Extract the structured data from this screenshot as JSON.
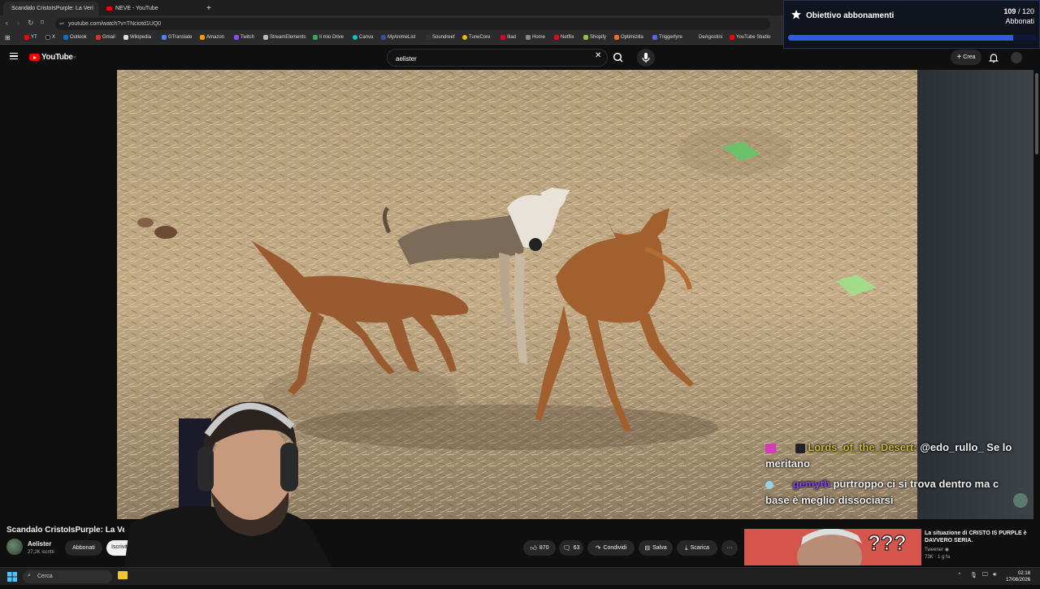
{
  "browser": {
    "tabs": [
      {
        "label": "Scandalo CristoIsPurple: La Veri",
        "active": true
      },
      {
        "label": "NEVE - YouTube",
        "active": false
      }
    ],
    "new_tab": "+",
    "url": "youtube.com/watch?v=TNciotd1UQ0",
    "bookmarks": [
      "YT",
      "X",
      "Outlook",
      "Gmail",
      "Wikipedia",
      "GTranslate",
      "Amazon",
      "Twitch",
      "StreamElements",
      "Il mio Drive",
      "Canva",
      "MyAnimeList",
      "Soundreef",
      "TuneCore",
      "Iliad",
      "Home",
      "Netflix",
      "Shopify",
      "Optimizilla",
      "Triggerfyre",
      "DeAgostini",
      "YouTube Studio"
    ]
  },
  "youtube": {
    "logo_text": "YouTube",
    "logo_region": "IT",
    "search_value": "aelister",
    "create_label": "Crea"
  },
  "goal": {
    "title": "Obiettivo abbonamenti",
    "current": "109",
    "separator": " / ",
    "target": "120",
    "unit": "Abbonati",
    "progress_fraction": 0.908
  },
  "chat": [
    {
      "user": "Lords_of_the_Desert:",
      "message": "@edo_rullo_ Se lo",
      "continuation": "meritano",
      "user_color": "#c9b33a"
    },
    {
      "user": "gemyth",
      "message": "purtroppo ci si trova dentro ma c",
      "continuation": "base è meglio dissociarsi",
      "user_color": "#8a46e6"
    }
  ],
  "video": {
    "title": "Scandalo CristoIsPurple: La Verità",
    "channel": "Aelister",
    "subscribers": "27,2K iscritti",
    "subscribed_label": "Abbonati",
    "subscribe_label": "Iscriviti",
    "likes": "870",
    "comments": "63",
    "share_label": "Condividi",
    "save_label": "Salva",
    "download_label": "Scarica",
    "more_label": "···"
  },
  "recommended": {
    "title": "La situazione di CRISTO IS PURPLE è DAVVERO SERIA.",
    "channel": "Tweener",
    "views": "73K",
    "age": "1 g fa",
    "thumb_text": "???"
  },
  "taskbar": {
    "search_placeholder": "Cerca",
    "time": "02:18",
    "date": "17/08/2026"
  },
  "colors": {
    "youtube_red": "#ff0000",
    "goal_bar": "#2f5be0",
    "page_bg": "#0f0f0f"
  }
}
